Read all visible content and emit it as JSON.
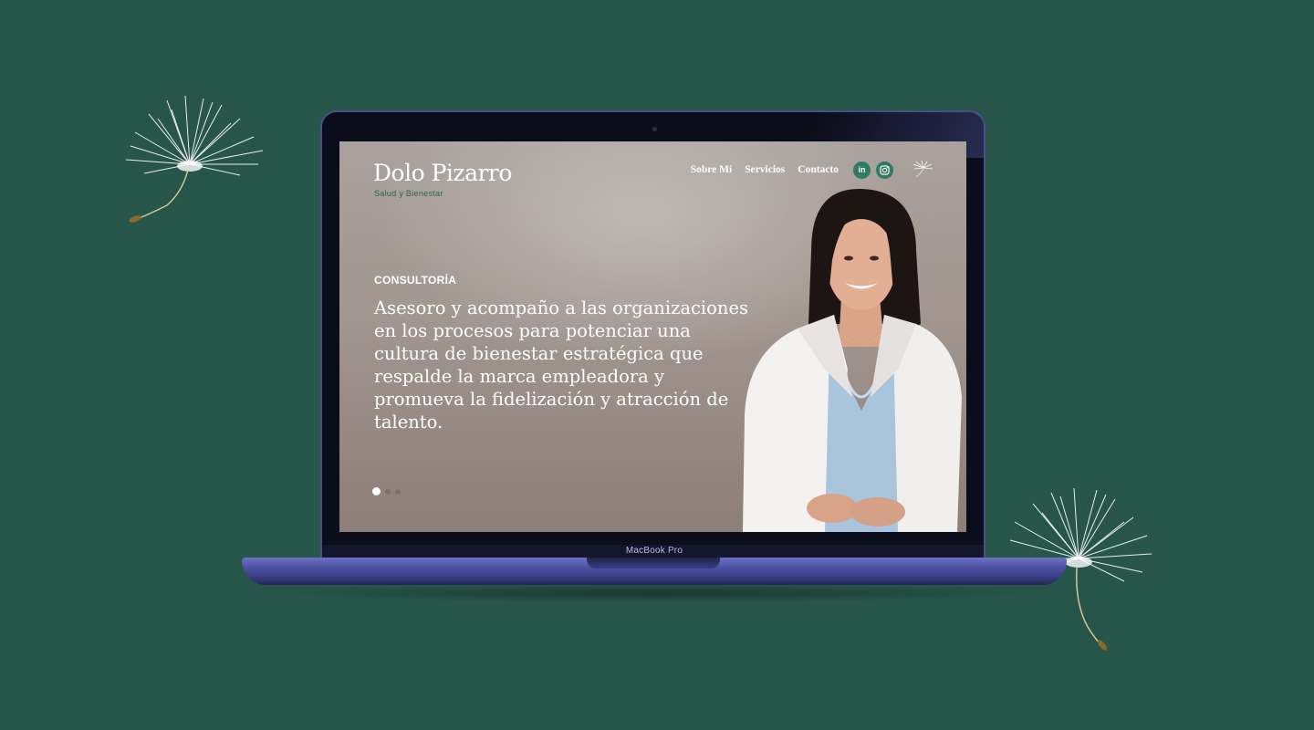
{
  "site": {
    "brand": "Dolo Pizarro",
    "tagline": "Salud y Bienestar",
    "nav": [
      "Sobre Mí",
      "Servicios",
      "Contacto"
    ],
    "social": [
      {
        "icon": "linkedin-icon",
        "text": "in"
      },
      {
        "icon": "instagram-icon",
        "text": ""
      }
    ]
  },
  "hero": {
    "eyebrow": "CONSULTORÍA",
    "headline": "Asesoro y acompaño a las organizaciones en los procesos para potenciar una cultura de bienestar estratégica que respalde la marca empleadora y promueva la fidelización y atracción de talento.",
    "slides": 3,
    "active_slide": 1
  },
  "device": {
    "label": "MacBook Pro"
  },
  "colors": {
    "background": "#27554a",
    "accent": "#2f7a64",
    "laptop": "#4d52a4"
  }
}
